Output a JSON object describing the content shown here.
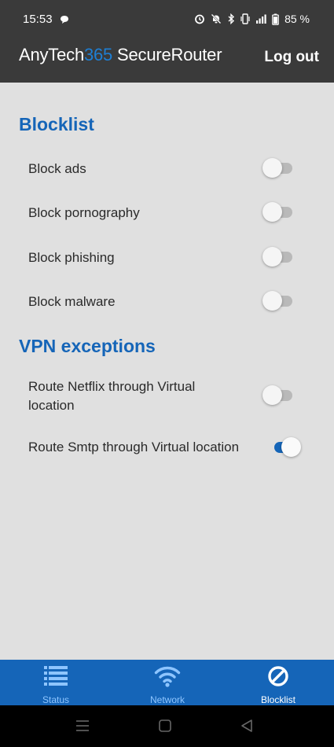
{
  "status_bar": {
    "time": "15:53",
    "battery": "85 %",
    "icons": [
      "chat-bubble-icon",
      "alarm-icon",
      "mute-icon",
      "bluetooth-icon",
      "vibrate-icon",
      "signal-icon",
      "battery-icon"
    ]
  },
  "header": {
    "title_prefix": "AnyTech",
    "title_accent": "365",
    "title_suffix": " SecureRouter",
    "logout_label": "Log out",
    "accent_color": "#1e7fd4"
  },
  "blocklist": {
    "title": "Blocklist",
    "items": [
      {
        "label": "Block ads",
        "enabled": false
      },
      {
        "label": "Block pornography",
        "enabled": false
      },
      {
        "label": "Block phishing",
        "enabled": false
      },
      {
        "label": "Block malware",
        "enabled": false
      }
    ]
  },
  "vpn_exceptions": {
    "title": "VPN exceptions",
    "items": [
      {
        "label": "Route Netflix through Virtual location",
        "enabled": false
      },
      {
        "label": "Route Smtp through Virtual location",
        "enabled": true
      }
    ]
  },
  "bottom_nav": {
    "items": [
      {
        "label": "Status",
        "icon": "list-icon",
        "active": false
      },
      {
        "label": "Network",
        "icon": "wifi-icon",
        "active": false
      },
      {
        "label": "Blocklist",
        "icon": "block-icon",
        "active": true
      }
    ]
  },
  "colors": {
    "primary": "#1565b8",
    "header_bg": "#3a3a3a",
    "content_bg": "#e0e0e0"
  }
}
